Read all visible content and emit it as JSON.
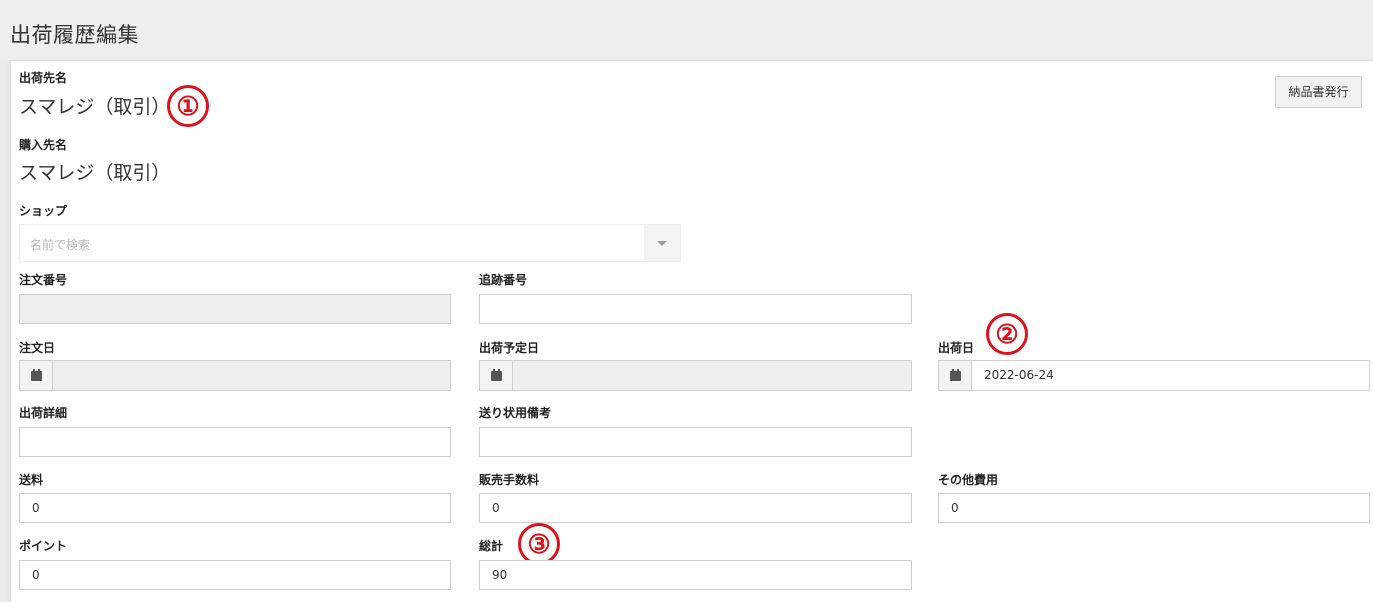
{
  "page": {
    "title": "出荷履歴編集"
  },
  "toolbar": {
    "issue_button_label": "納品書発行"
  },
  "form": {
    "ship_to": {
      "label": "出荷先名",
      "value": "スマレジ（取引）"
    },
    "buyer": {
      "label": "購入先名",
      "value": "スマレジ（取引）"
    },
    "shop": {
      "label": "ショップ",
      "placeholder": "名前で検索"
    },
    "order_number": {
      "label": "注文番号",
      "value": ""
    },
    "tracking_number": {
      "label": "追跡番号",
      "value": ""
    },
    "order_date": {
      "label": "注文日",
      "value": ""
    },
    "scheduled_ship_date": {
      "label": "出荷予定日",
      "value": ""
    },
    "ship_date": {
      "label": "出荷日",
      "value": "2022-06-24"
    },
    "ship_details": {
      "label": "出荷詳細",
      "value": ""
    },
    "invoice_note": {
      "label": "送り状用備考",
      "value": ""
    },
    "shipping_fee": {
      "label": "送料",
      "value": "0"
    },
    "sales_commission": {
      "label": "販売手数料",
      "value": "0"
    },
    "other_costs": {
      "label": "その他費用",
      "value": "0"
    },
    "points": {
      "label": "ポイント",
      "value": "0"
    },
    "total": {
      "label": "総計",
      "value": "90"
    }
  },
  "annotations": {
    "marker_1": "①",
    "marker_2": "②",
    "marker_3": "③"
  },
  "colors": {
    "annotation": "#d9141e",
    "readonly_field": "#eeeeee",
    "page_bg": "#eeeeee"
  },
  "icons": {
    "date_addon": "calendar-icon",
    "select_toggle": "chevron-down-icon"
  }
}
